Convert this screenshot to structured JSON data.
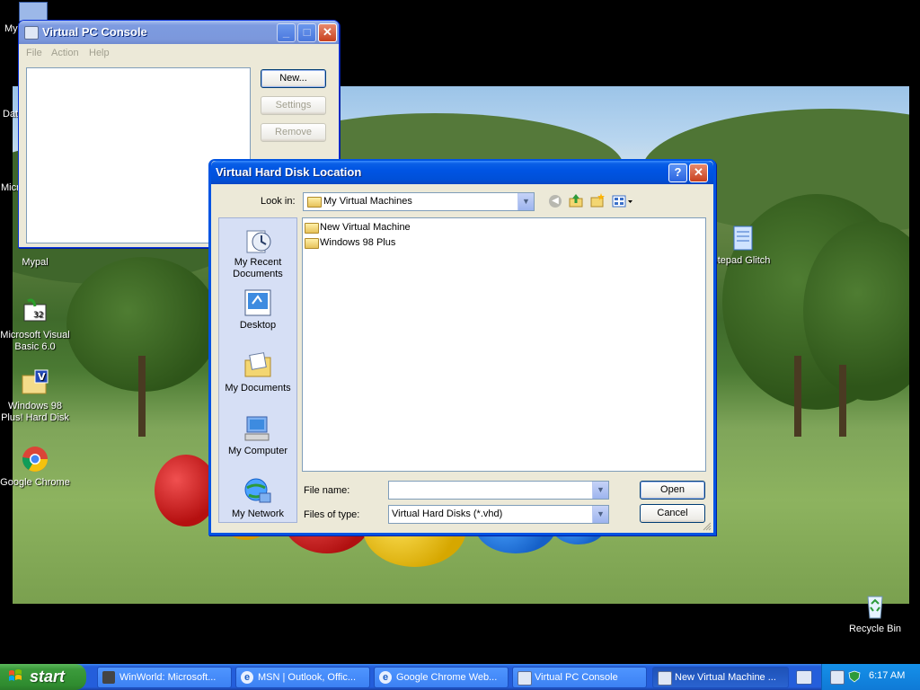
{
  "desktop": {
    "icons": [
      {
        "label": "My"
      },
      {
        "label": "Dat"
      },
      {
        "label": "Micr"
      },
      {
        "label": "Mypal"
      },
      {
        "label": "Microsoft Visual Basic 6.0"
      },
      {
        "label": "Windows 98 Plus! Hard Disk"
      },
      {
        "label": "Google Chrome"
      },
      {
        "label": "otepad Glitch"
      },
      {
        "label": "Recycle Bin"
      }
    ]
  },
  "console": {
    "title": "Virtual PC Console",
    "menu": [
      "File",
      "Action",
      "Help"
    ],
    "buttons": {
      "new": "New...",
      "settings": "Settings",
      "remove": "Remove"
    }
  },
  "dialog": {
    "title": "Virtual Hard Disk Location",
    "look_in_label": "Look in:",
    "look_in_value": "My Virtual Machines",
    "places": [
      "My Recent Documents",
      "Desktop",
      "My Documents",
      "My Computer",
      "My Network"
    ],
    "files": [
      "New Virtual Machine",
      "Windows 98 Plus"
    ],
    "file_name_label": "File name:",
    "file_name_value": "",
    "files_of_type_label": "Files of type:",
    "files_of_type_value": "Virtual Hard Disks (*.vhd)",
    "open_label": "Open",
    "cancel_label": "Cancel"
  },
  "taskbar": {
    "start_label": "start",
    "tasks": [
      {
        "label": "WinWorld: Microsoft..."
      },
      {
        "label": "MSN | Outlook, Offic..."
      },
      {
        "label": "Google Chrome Web..."
      },
      {
        "label": "Virtual PC Console"
      },
      {
        "label": "New Virtual Machine ..."
      }
    ],
    "clock": "6:17 AM"
  },
  "colors": {
    "xp_blue": "#0054e3",
    "taskbar": "#245edb",
    "start_green": "#3c9b3c",
    "dialog_bg": "#ece9d8"
  }
}
